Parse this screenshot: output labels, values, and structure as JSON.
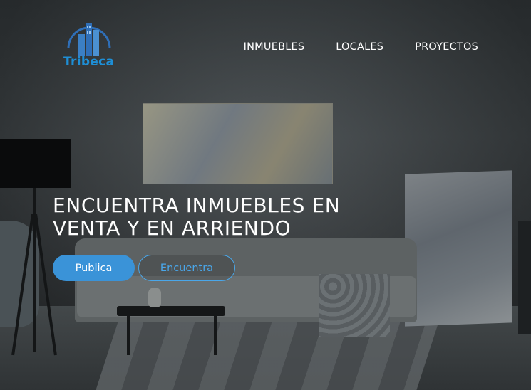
{
  "brand": {
    "name": "Tribeca",
    "color": "#1e8fd6"
  },
  "nav": {
    "items": [
      {
        "label": "INMUEBLES"
      },
      {
        "label": "LOCALES"
      },
      {
        "label": "PROYECTOS"
      }
    ]
  },
  "hero": {
    "headline_line1": "ENCUENTRA INMUEBLES EN",
    "headline_line2": "VENTA Y EN ARRIENDO",
    "primary_button": "Publica",
    "secondary_button": "Encuentra",
    "accent": "#3a93d8"
  },
  "icons": [
    "building-logo-icon"
  ]
}
